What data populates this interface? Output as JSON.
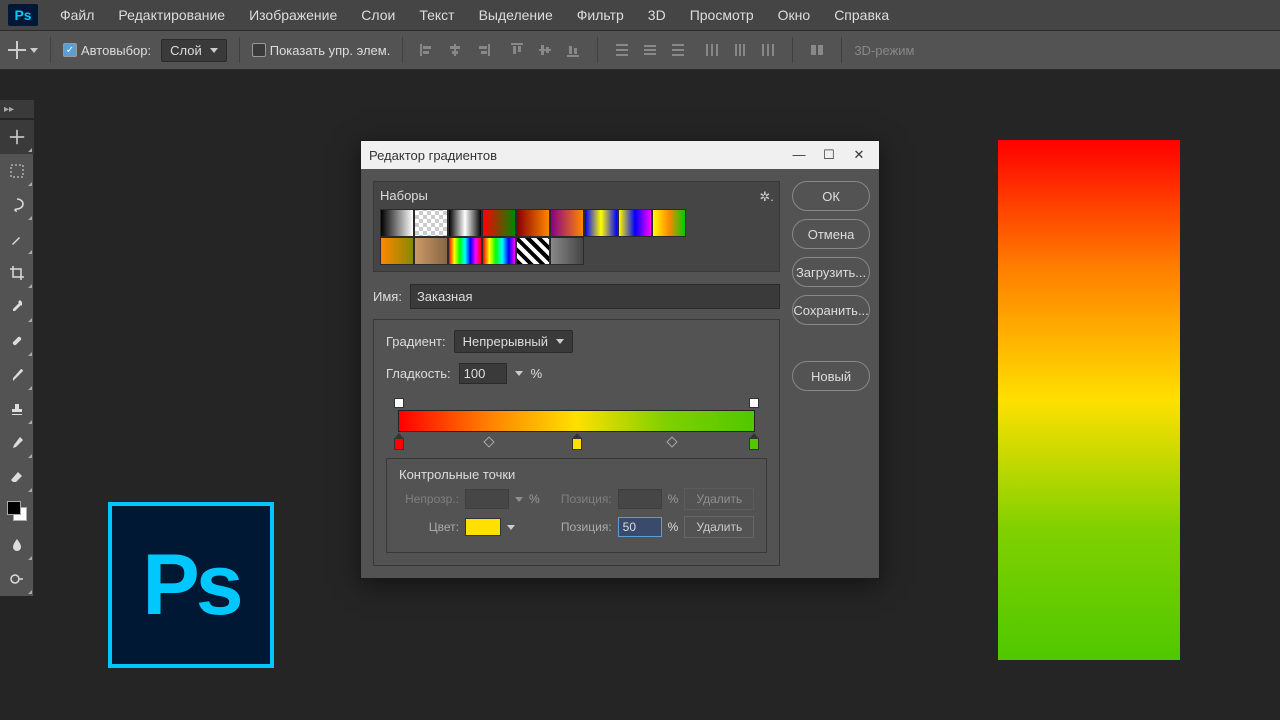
{
  "menubar": [
    "Файл",
    "Редактирование",
    "Изображение",
    "Слои",
    "Текст",
    "Выделение",
    "Фильтр",
    "3D",
    "Просмотр",
    "Окно",
    "Справка"
  ],
  "optbar": {
    "auto": "Автовыбор:",
    "layer": "Слой",
    "show": "Показать упр. элем.",
    "mode3d": "3D-режим"
  },
  "dialog": {
    "title": "Редактор градиентов",
    "presets_label": "Наборы",
    "ok": "ОК",
    "cancel": "Отмена",
    "load": "Загрузить...",
    "save": "Сохранить...",
    "new": "Новый",
    "name_label": "Имя:",
    "name_value": "Заказная",
    "grad_label": "Градиент:",
    "grad_type": "Непрерывный",
    "smooth_label": "Гладкость:",
    "smooth_value": "100",
    "pct": "%",
    "cp_title": "Контрольные точки",
    "opacity_label": "Непрозр.:",
    "position_label": "Позиция:",
    "delete": "Удалить",
    "color_label": "Цвет:",
    "pos_value": "50",
    "swatches": [
      "linear-gradient(to right,#000,#fff)",
      "repeating-conic-gradient(#ccc 0 25%,#fff 0 50%) 0/8px 8px",
      "linear-gradient(to right,#000,#fff,#000)",
      "linear-gradient(to right,#f00,#080)",
      "linear-gradient(to right,#800,#f80)",
      "linear-gradient(to right,#808,#f80)",
      "linear-gradient(to right,#00f,#ff0,#00f)",
      "linear-gradient(to right,#ff0,#00f,#f0f)",
      "linear-gradient(to right,#ff0,#f80,#0c0)",
      "linear-gradient(to right,#f80,#880)",
      "linear-gradient(to right,#c96,#864)",
      "linear-gradient(to right,#f00,#ff0,#0f0,#0ff,#00f,#f0f,#f00)",
      "linear-gradient(to right,#f00,#ff0,#0f0,#0ff,#00f,#f0f)",
      "repeating-linear-gradient(45deg,#000 0 4px,#fff 4px 8px)",
      "linear-gradient(to right,#888,rgba(136,136,136,0))"
    ]
  }
}
